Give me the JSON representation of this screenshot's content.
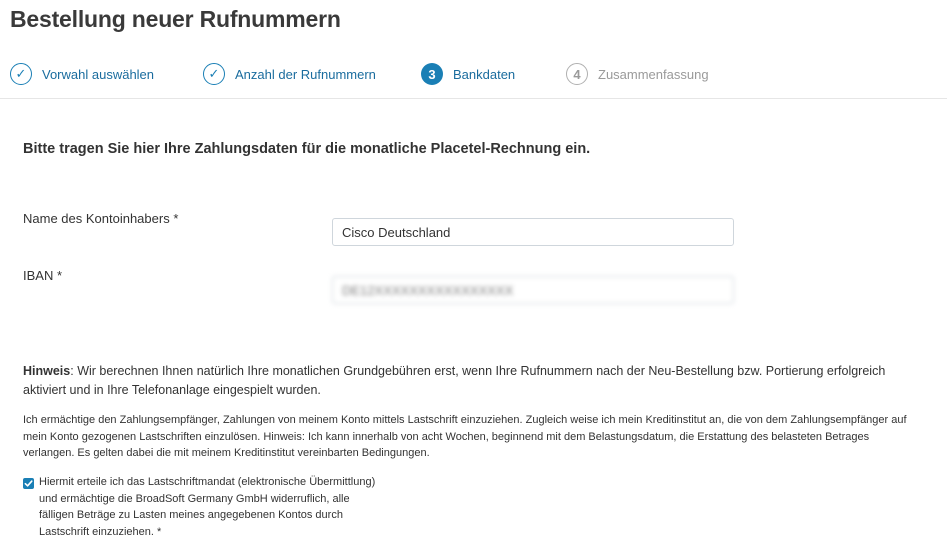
{
  "page": {
    "title": "Bestellung neuer Rufnummern"
  },
  "steps": [
    {
      "state": "done",
      "marker": "✓",
      "label": "Vorwahl auswählen"
    },
    {
      "state": "done",
      "marker": "✓",
      "label": "Anzahl der Rufnummern"
    },
    {
      "state": "active",
      "marker": "3",
      "label": "Bankdaten"
    },
    {
      "state": "todo",
      "marker": "4",
      "label": "Zusammenfassung"
    }
  ],
  "form": {
    "intro": "Bitte tragen Sie hier Ihre Zahlungsdaten für die monatliche Placetel-Rechnung ein.",
    "account_holder_label": "Name des Kontoinhabers *",
    "account_holder_value": "Cisco Deutschland",
    "iban_label": "IBAN *",
    "iban_value": "DE12XXXXXXXXXXXXXXXX"
  },
  "notice": {
    "label": "Hinweis",
    "text": ": Wir berechnen Ihnen natürlich Ihre monatlichen Grundgebühren erst, wenn Ihre Rufnummern nach der Neu-Bestellung bzw. Portierung erfolgreich aktiviert und in Ihre Telefonanlage eingespielt wurden."
  },
  "mandate": {
    "text": "Ich ermächtige den Zahlungsempfänger, Zahlungen von meinem Konto mittels Lastschrift einzuziehen. Zugleich weise ich mein Kreditinstitut an, die von dem Zahlungsempfänger auf mein Konto gezogenen Lastschriften einzulösen. Hinweis: Ich kann innerhalb von acht Wochen, beginnend mit dem Belastungsdatum, die Erstattung des belasteten Betrages verlangen. Es gelten dabei die mit meinem Kreditinstitut vereinbarten Bedingungen.",
    "checkbox_checked": true,
    "checkbox_label": "Hiermit erteile ich das Lastschriftmandat (elektronische Übermittlung) und ermächtige die BroadSoft Germany GmbH widerruflich, alle fälligen Beträge zu Lasten meines angegebenen Kontos durch Lastschrift einzuziehen.  *"
  },
  "colors": {
    "accent": "#1a7fb5",
    "inactive": "#9a9a9a"
  }
}
